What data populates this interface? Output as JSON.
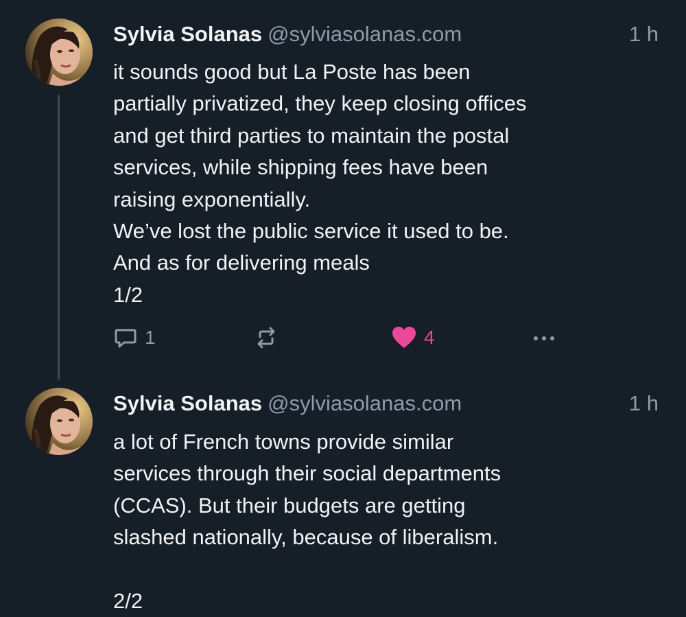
{
  "posts": [
    {
      "author_name": "Sylvia Solanas",
      "author_handle": "@sylviasolanas.com",
      "timestamp": "1 h",
      "text": "it sounds good but La Poste has been\npartially privatized, they keep closing offices\nand get third parties to maintain the postal\nservices, while shipping fees have been\nraising exponentially.\nWe’ve lost the public service it used to be.\nAnd as for delivering meals\n1/2",
      "reply_count": "1",
      "like_count": "4"
    },
    {
      "author_name": "Sylvia Solanas",
      "author_handle": "@sylviasolanas.com",
      "timestamp": "1 h",
      "text": "a lot of French towns provide similar\nservices through their social departments\n(CCAS). But their budgets are getting\nslashed nationally, because of liberalism.\n\n2/2"
    }
  ],
  "colors": {
    "background": "#161e27",
    "text": "#f1f3f5",
    "muted": "#8d9bab",
    "like": "#ec4899",
    "thread_line": "#3a4a5c"
  },
  "icons": {
    "reply": "speech-bubble-icon",
    "repost": "repost-arrows-icon",
    "like": "heart-icon",
    "more": "ellipsis-icon"
  }
}
